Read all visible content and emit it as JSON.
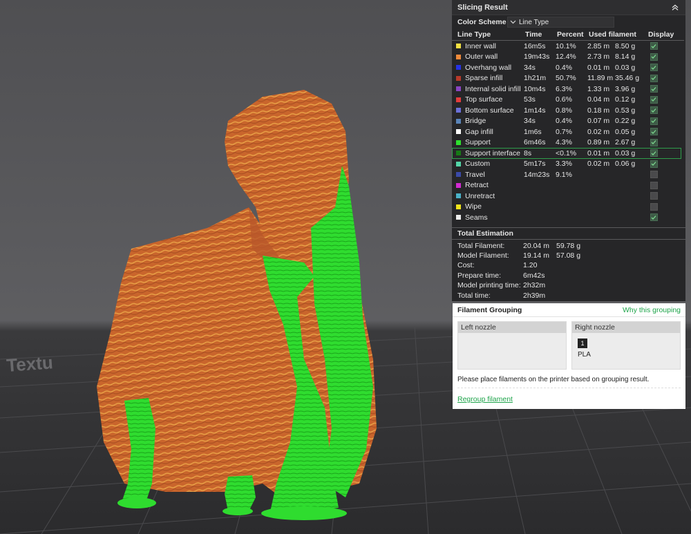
{
  "panel": {
    "title": "Slicing Result",
    "color_scheme_label": "Color Scheme",
    "color_scheme_value": "Line Type",
    "columns": {
      "type": "Line Type",
      "time": "Time",
      "percent": "Percent",
      "used": "Used filament",
      "display": "Display"
    },
    "rows": [
      {
        "name": "Inner wall",
        "color": "#f5e042",
        "time": "16m5s",
        "percent": "10.1%",
        "length": "2.85 m",
        "weight": "8.50 g",
        "display": true
      },
      {
        "name": "Outer wall",
        "color": "#f08a3a",
        "time": "19m43s",
        "percent": "12.4%",
        "length": "2.73 m",
        "weight": "8.14 g",
        "display": true
      },
      {
        "name": "Overhang wall",
        "color": "#2533e6",
        "time": "34s",
        "percent": "0.4%",
        "length": "0.01 m",
        "weight": "0.03 g",
        "display": true
      },
      {
        "name": "Sparse infill",
        "color": "#b83a2a",
        "time": "1h21m",
        "percent": "50.7%",
        "length": "11.89 m",
        "weight": "35.46 g",
        "display": true
      },
      {
        "name": "Internal solid infill",
        "color": "#8a44c2",
        "time": "10m4s",
        "percent": "6.3%",
        "length": "1.33 m",
        "weight": "3.96 g",
        "display": true
      },
      {
        "name": "Top surface",
        "color": "#e23c3c",
        "time": "53s",
        "percent": "0.6%",
        "length": "0.04 m",
        "weight": "0.12 g",
        "display": true
      },
      {
        "name": "Bottom surface",
        "color": "#6b70d8",
        "time": "1m14s",
        "percent": "0.8%",
        "length": "0.18 m",
        "weight": "0.53 g",
        "display": true
      },
      {
        "name": "Bridge",
        "color": "#5a84b8",
        "time": "34s",
        "percent": "0.4%",
        "length": "0.07 m",
        "weight": "0.22 g",
        "display": true
      },
      {
        "name": "Gap infill",
        "color": "#ffffff",
        "time": "1m6s",
        "percent": "0.7%",
        "length": "0.02 m",
        "weight": "0.05 g",
        "display": true
      },
      {
        "name": "Support",
        "color": "#2ee12e",
        "time": "6m46s",
        "percent": "4.3%",
        "length": "0.89 m",
        "weight": "2.67 g",
        "display": true
      },
      {
        "name": "Support interface",
        "color": "#167a16",
        "time": "8s",
        "percent": "<0.1%",
        "length": "0.01 m",
        "weight": "0.03 g",
        "display": true
      },
      {
        "name": "Custom",
        "color": "#54d6a8",
        "time": "5m17s",
        "percent": "3.3%",
        "length": "0.02 m",
        "weight": "0.06 g",
        "display": true
      },
      {
        "name": "Travel",
        "color": "#3a4aa8",
        "time": "14m23s",
        "percent": "9.1%",
        "length": "",
        "weight": "",
        "display": false
      },
      {
        "name": "Retract",
        "color": "#d22ad2",
        "time": "",
        "percent": "",
        "length": "",
        "weight": "",
        "display": false
      },
      {
        "name": "Unretract",
        "color": "#4ab2c8",
        "time": "",
        "percent": "",
        "length": "",
        "weight": "",
        "display": false
      },
      {
        "name": "Wipe",
        "color": "#f2e41c",
        "time": "",
        "percent": "",
        "length": "",
        "weight": "",
        "display": false
      },
      {
        "name": "Seams",
        "color": "#ececec",
        "time": "",
        "percent": "",
        "length": "",
        "weight": "",
        "display": true
      }
    ],
    "selected_row": "Support interface",
    "total_title": "Total Estimation",
    "totals": [
      {
        "key": "Total Filament:",
        "v1": "20.04 m",
        "v2": "59.78 g"
      },
      {
        "key": "Model Filament:",
        "v1": "19.14 m",
        "v2": "57.08 g"
      },
      {
        "key": "Cost:",
        "v1": "1.20",
        "v2": ""
      },
      {
        "key": "Prepare time:",
        "v1": "6m42s",
        "v2": ""
      },
      {
        "key": "Model printing time:",
        "v1": "2h32m",
        "v2": ""
      },
      {
        "key": "Total time:",
        "v1": "2h39m",
        "v2": ""
      }
    ]
  },
  "grouping": {
    "title": "Filament Grouping",
    "why_link": "Why this grouping",
    "left_nozzle": "Left nozzle",
    "right_nozzle": "Right nozzle",
    "filament_number": "1",
    "filament_name": "PLA",
    "message": "Please place filaments on the printer based on grouping result.",
    "regroup": "Regroup filament"
  },
  "scene": {
    "plate_text": "Textu",
    "model_color": "#c8622a",
    "support_color": "#2ee12e",
    "bed_color": "#2e2e30"
  }
}
